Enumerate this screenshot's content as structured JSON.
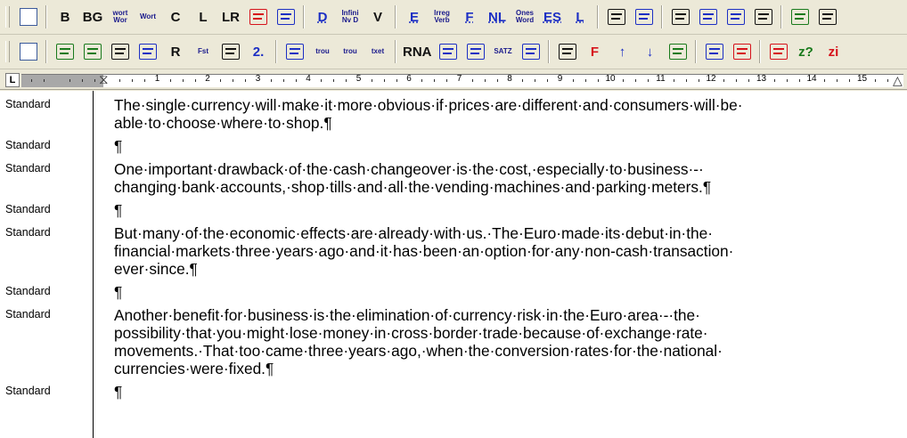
{
  "toolbar1": {
    "buttons": [
      {
        "label": "",
        "icon": "document-icon",
        "style": "box"
      },
      {
        "label": "B",
        "style": "black"
      },
      {
        "label": "BG",
        "style": "black"
      },
      {
        "label": "wort Wor",
        "style": "small"
      },
      {
        "label": "Wort",
        "style": "small"
      },
      {
        "label": "C",
        "style": "black"
      },
      {
        "label": "L",
        "style": "black"
      },
      {
        "label": "LR",
        "style": "black"
      },
      {
        "label": "",
        "icon": "highlight-icon",
        "style": "red"
      },
      {
        "label": "",
        "icon": "insert-icon",
        "style": "blue"
      },
      {
        "label": "D",
        "style": "blue u"
      },
      {
        "label": "Infini Nv D",
        "style": "small"
      },
      {
        "label": "V",
        "style": "black"
      },
      {
        "label": "E",
        "style": "blue u"
      },
      {
        "label": "Irreg Verb",
        "style": "small"
      },
      {
        "label": "F",
        "style": "blue u"
      },
      {
        "label": "NL",
        "style": "blue u"
      },
      {
        "label": "Ones Word",
        "style": "small"
      },
      {
        "label": "ES",
        "style": "blue u"
      },
      {
        "label": "L",
        "style": "blue u"
      },
      {
        "label": "",
        "icon": "books-icon",
        "style": "black"
      },
      {
        "label": "",
        "icon": "grid-icon",
        "style": "blue"
      },
      {
        "label": "",
        "icon": "list-icon",
        "style": "black"
      },
      {
        "label": "",
        "icon": "align-icon",
        "style": "blue"
      },
      {
        "label": "",
        "icon": "columns-icon",
        "style": "blue"
      },
      {
        "label": "",
        "icon": "word-stats-icon",
        "style": "black"
      },
      {
        "label": "",
        "icon": "chinese-char-icon",
        "style": "green"
      },
      {
        "label": "",
        "icon": "smiley-icon",
        "style": "black"
      }
    ]
  },
  "toolbar2": {
    "buttons": [
      {
        "label": "",
        "icon": "document-icon",
        "style": "box"
      },
      {
        "label": "",
        "icon": "tool-a-icon",
        "style": "green"
      },
      {
        "label": "",
        "icon": "tool-b-icon",
        "style": "green"
      },
      {
        "label": "",
        "icon": "table-icon",
        "style": "black"
      },
      {
        "label": "",
        "icon": "wand-icon",
        "style": "blue"
      },
      {
        "label": "R",
        "style": "black"
      },
      {
        "label": "Fst",
        "style": "small"
      },
      {
        "label": "",
        "icon": "key-icon",
        "style": "black"
      },
      {
        "label": "2.",
        "style": "blue"
      },
      {
        "label": "",
        "icon": "word-a-icon",
        "style": "blue"
      },
      {
        "label": "trou",
        "style": "small"
      },
      {
        "label": "trou",
        "style": "small"
      },
      {
        "label": "txet",
        "style": "small"
      },
      {
        "label": "RNA",
        "style": "black"
      },
      {
        "label": "",
        "icon": "swap-a-icon",
        "style": "blue"
      },
      {
        "label": "",
        "icon": "swap-b-icon",
        "style": "blue"
      },
      {
        "label": "SATZ",
        "style": "small"
      },
      {
        "label": "",
        "icon": "sheet-icon",
        "style": "blue"
      },
      {
        "label": "",
        "icon": "hook-icon",
        "style": "black"
      },
      {
        "label": "F",
        "style": "red"
      },
      {
        "label": "↑",
        "style": "blue"
      },
      {
        "label": "↓",
        "style": "blue"
      },
      {
        "label": "",
        "icon": "sort-icon",
        "style": "green"
      },
      {
        "label": "",
        "icon": "bucket-icon",
        "style": "blue"
      },
      {
        "label": "",
        "icon": "eraser-icon",
        "style": "red"
      },
      {
        "label": "",
        "icon": "shoe-icon",
        "style": "red"
      },
      {
        "label": "z?",
        "style": "green"
      },
      {
        "label": "zi",
        "style": "red"
      }
    ]
  },
  "ruler": {
    "tab_selector": "L",
    "numbers": [
      "1",
      "2",
      "3",
      "4",
      "5",
      "6",
      "7",
      "8",
      "9",
      "10",
      "11",
      "12",
      "13",
      "14",
      "15"
    ]
  },
  "document": {
    "paragraphs": [
      {
        "style": "Standard",
        "lines": [
          "The·single·currency·will·make·it·more·obvious·if·prices·are·different·and·consumers·will·be·",
          "able·to·choose·where·to·shop.¶"
        ]
      },
      {
        "style": "Standard",
        "lines": [
          "¶"
        ]
      },
      {
        "style": "Standard",
        "lines": [
          "One·important·drawback·of·the·cash·changeover·is·the·cost,·especially·to·business·-·",
          "changing·bank·accounts,·shop·tills·and·all·the·vending·machines·and·parking·meters.¶"
        ]
      },
      {
        "style": "Standard",
        "lines": [
          "¶"
        ]
      },
      {
        "style": "Standard",
        "lines": [
          "But·many·of·the·economic·effects·are·already·with·us.·The·Euro·made·its·debut·in·the·",
          "financial·markets·three·years·ago·and·it·has·been·an·option·for·any·non-cash·transaction·",
          "ever·since.¶"
        ]
      },
      {
        "style": "Standard",
        "lines": [
          "¶"
        ]
      },
      {
        "style": "Standard",
        "lines": [
          "Another·benefit·for·business·is·the·elimination·of·currency·risk·in·the·Euro·area·-·the·",
          "possibility·that·you·might·lose·money·in·cross·border·trade·because·of·exchange·rate·",
          "movements.·That·too·came·three·years·ago,·when·the·conversion·rates·for·the·national·",
          "currencies·were·fixed.¶"
        ]
      },
      {
        "style": "Standard",
        "lines": [
          "¶"
        ]
      }
    ]
  }
}
